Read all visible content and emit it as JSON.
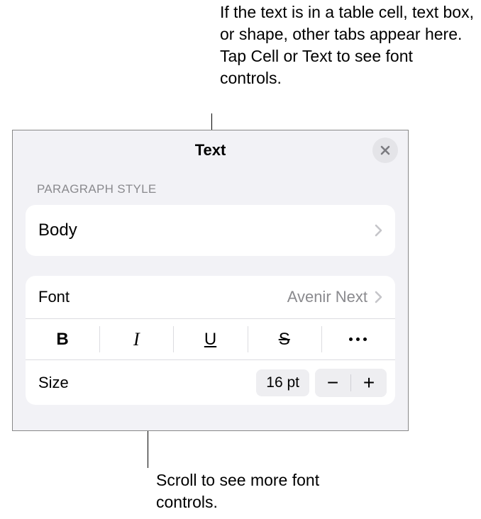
{
  "callouts": {
    "top": "If the text is in a table cell, text box, or shape, other tabs appear here. Tap Cell or Text to see font controls.",
    "bottom": "Scroll to see more font controls."
  },
  "panel": {
    "title": "Text",
    "section_label": "PARAGRAPH STYLE",
    "paragraph_style": "Body",
    "font_label": "Font",
    "font_value": "Avenir Next",
    "format": {
      "bold": "B",
      "italic": "I",
      "underline": "U",
      "strike": "S"
    },
    "size_label": "Size",
    "size_value": "16 pt",
    "stepper_minus": "−",
    "stepper_plus": "+"
  }
}
